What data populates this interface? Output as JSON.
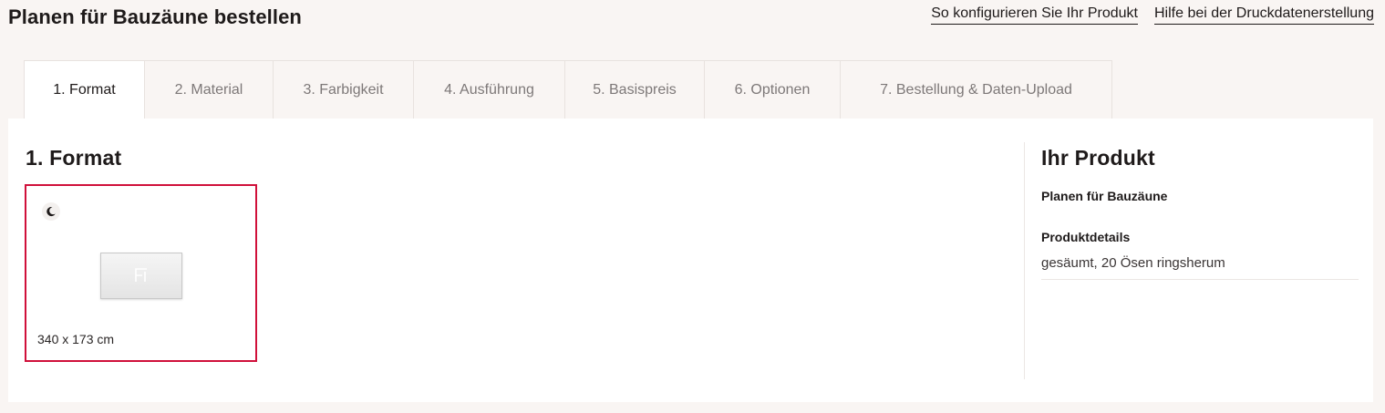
{
  "header": {
    "title": "Planen für Bauzäune bestellen",
    "links": [
      {
        "label": "So konfigurieren Sie Ihr Produkt"
      },
      {
        "label": "Hilfe bei der Druckdatenerstellung"
      }
    ]
  },
  "tabs": [
    {
      "label": "1. Format",
      "active": true
    },
    {
      "label": "2. Material"
    },
    {
      "label": "3. Farbigkeit"
    },
    {
      "label": "4. Ausführung"
    },
    {
      "label": "5. Basispreis"
    },
    {
      "label": "6. Optionen"
    },
    {
      "label": "7. Bestellung & Daten-Upload"
    }
  ],
  "main": {
    "section_title": "1. Format",
    "format_option": {
      "label": "340 x 173 cm",
      "icon": "moon-icon",
      "selected_color": "#d0103a"
    }
  },
  "summary": {
    "title": "Ihr Produkt",
    "product_name": "Planen für Bauzäune",
    "details_label": "Produktdetails",
    "details_value": "gesäumt, 20 Ösen ringsherum"
  }
}
